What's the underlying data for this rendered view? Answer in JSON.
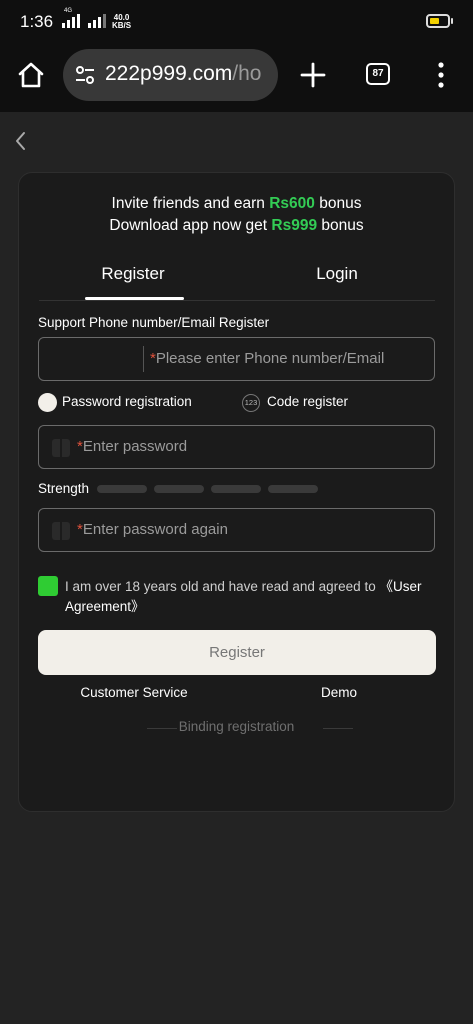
{
  "status_bar": {
    "time": "1:36",
    "net_label": "4G",
    "speed_value": "40.0",
    "speed_unit": "KB/S",
    "battery_color": "#f2d000"
  },
  "browser": {
    "url_main": "222p999.com",
    "url_faded": "/ho",
    "tab_count": "87",
    "icons": [
      "home-icon",
      "tune-icon",
      "plus-icon",
      "tabs-icon",
      "menu-dots-icon"
    ]
  },
  "page": {
    "back_icon": "chevron-left-icon",
    "banner": {
      "line1_prefix": "Invite friends and earn ",
      "line1_amount": "Rs600",
      "line1_suffix": " bonus",
      "line2_prefix": "Download app now get ",
      "line2_amount": "Rs999",
      "line2_suffix": " bonus",
      "accent_color": "#33cc55"
    },
    "tabs": [
      {
        "label": "Register",
        "active": true
      },
      {
        "label": "Login",
        "active": false
      }
    ],
    "form": {
      "section_label": "Support Phone number/Email Register",
      "phone_placeholder": "Please enter Phone number/Email",
      "required_mark": "*",
      "options": [
        {
          "label": "Password registration",
          "selected": true
        },
        {
          "label": "Code register",
          "badge": "123",
          "selected": false
        }
      ],
      "password_placeholder": "Enter password",
      "strength_label": "Strength",
      "strength_level": 0,
      "confirm_placeholder": "Enter password again",
      "agreement_text": "I am over 18 years old and have read and agreed to ",
      "agreement_link": "《User Agreement》",
      "agreement_checked": true,
      "register_button": "Register"
    },
    "footer": {
      "customer_service": "Customer Service",
      "demo": "Demo",
      "binding": "Binding registration"
    }
  }
}
